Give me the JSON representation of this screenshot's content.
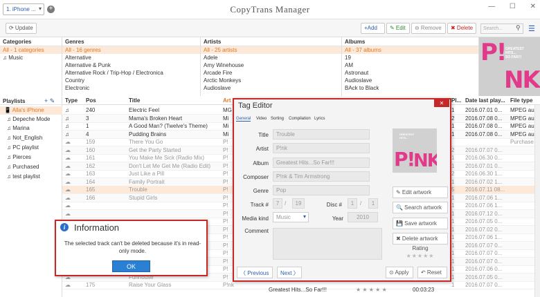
{
  "topbar": {
    "device": "1. iPhone ...",
    "add_device_glyph": "+",
    "app_title": "CopyTrans Manager",
    "window_controls": [
      "—",
      "☐",
      "✕"
    ]
  },
  "toolbar": {
    "update_label": "⟳ Update",
    "add_label": "+Add",
    "edit_label": "✎ Edit",
    "remove_label": "⊖ Remove",
    "delete_label": "✖ Delete",
    "search_placeholder": "Search..."
  },
  "categories": {
    "header": "Categories",
    "items": [
      "All - 1 categories",
      "♫ Music"
    ]
  },
  "genres": {
    "header": "Genres",
    "items": [
      "All - 16 genres",
      "Alternative",
      "Alternative & Punk",
      "Alternative Rock / Trip-Hop / Electronica",
      "Country",
      "Electronic"
    ]
  },
  "artists": {
    "header": "Artists",
    "items": [
      "All - 25 artists",
      "Adele",
      "Amy Winehouse",
      "Arcade Fire",
      "Arctic Monkeys",
      "Audioslave"
    ]
  },
  "albums": {
    "header": "Albums",
    "items": [
      "All - 37 albums",
      "19",
      "AM",
      "Astronaut",
      "Audioslave",
      "BAck to Black"
    ]
  },
  "playlists": {
    "header": "Playlists",
    "tools": "+ ✎",
    "items": [
      "Alla's iPhone",
      "Depeche Mode",
      "Marina",
      "Not_English",
      "PC playlist",
      "Pierces",
      "Purchased",
      "test playlist"
    ]
  },
  "table": {
    "headers": [
      "Type",
      "Pos",
      "Title",
      "Art",
      "Pl...",
      "Date last play...",
      "File type"
    ],
    "rows": [
      {
        "type": "♫",
        "pos": "240",
        "title": "Electric Feel",
        "artist": "MG",
        "pl": "1",
        "date": "2016.07.01 0...",
        "ftype": "MPEG au"
      },
      {
        "type": "♫",
        "pos": "3",
        "title": "Mama's Broken Heart",
        "artist": "Mi",
        "pl": "2",
        "date": "2016.07.08 0...",
        "ftype": "MPEG au"
      },
      {
        "type": "♫",
        "pos": "1",
        "title": "A Good Man? (Twelve's Theme)",
        "artist": "Mi",
        "pl": "1",
        "date": "2016.07.08 0...",
        "ftype": "MPEG au"
      },
      {
        "type": "♫",
        "pos": "4",
        "title": "Pudding Brains",
        "artist": "Mi",
        "pl": "1",
        "date": "2016.07.08 0...",
        "ftype": "MPEG au"
      },
      {
        "type": "☁",
        "pos": "159",
        "title": "There You Go",
        "artist": "P!",
        "pl": "",
        "date": "",
        "ftype": "Purchase"
      },
      {
        "type": "☁",
        "pos": "160",
        "title": "Get the Party Started",
        "artist": "P!",
        "pl": "2",
        "date": "2016.07.07 0...",
        "ftype": ""
      },
      {
        "type": "☁",
        "pos": "161",
        "title": "You Make Me Sick (Radio Mix)",
        "artist": "P!",
        "pl": "1",
        "date": "2016.06.30 0...",
        "ftype": ""
      },
      {
        "type": "☁",
        "pos": "162",
        "title": "Don't Let Me Get Me (Radio Edit)",
        "artist": "P!",
        "pl": "1",
        "date": "2016.07.01 0...",
        "ftype": ""
      },
      {
        "type": "☁",
        "pos": "163",
        "title": "Just Like a Pill",
        "artist": "P!",
        "pl": "2",
        "date": "2016.06.30 1...",
        "ftype": ""
      },
      {
        "type": "☁",
        "pos": "164",
        "title": "Family Portrait",
        "artist": "P!",
        "pl": "1",
        "date": "2016.07.02 1...",
        "ftype": ""
      },
      {
        "type": "☁",
        "pos": "165",
        "title": "Trouble",
        "artist": "P!",
        "pl": "5",
        "date": "2016.07.11 08...",
        "ftype": ""
      },
      {
        "type": "☁",
        "pos": "166",
        "title": "Stupid Girls",
        "artist": "P!",
        "pl": "1",
        "date": "2016.07.06 1...",
        "ftype": ""
      },
      {
        "type": "☁",
        "pos": "",
        "title": "",
        "artist": "P!",
        "pl": "1",
        "date": "2016.07.06 1...",
        "ftype": ""
      },
      {
        "type": "☁",
        "pos": "",
        "title": "",
        "artist": "P!",
        "pl": "1",
        "date": "2016.07.12 0...",
        "ftype": ""
      },
      {
        "type": "☁",
        "pos": "",
        "title": "",
        "artist": "P!",
        "pl": "1",
        "date": "2016.07.05 0...",
        "ftype": ""
      },
      {
        "type": "☁",
        "pos": "",
        "title": "",
        "artist": "P!",
        "pl": "1",
        "date": "2016.07.02 0...",
        "ftype": ""
      },
      {
        "type": "☁",
        "pos": "",
        "title": "",
        "artist": "P!",
        "pl": "1",
        "date": "2016.07.06 1...",
        "ftype": ""
      },
      {
        "type": "☁",
        "pos": "",
        "title": "",
        "artist": "P!",
        "pl": "1",
        "date": "2016.07.07 0...",
        "ftype": ""
      },
      {
        "type": "☁",
        "pos": "",
        "title": "",
        "artist": "P!",
        "pl": "1",
        "date": "2016.07.07 0...",
        "ftype": ""
      },
      {
        "type": "☁",
        "pos": "",
        "title": "",
        "artist": "P!",
        "pl": "1",
        "date": "2016.07.07 0...",
        "ftype": ""
      },
      {
        "type": "☁",
        "pos": "",
        "title": "",
        "artist": "P!",
        "pl": "1",
        "date": "2016.07.06 0...",
        "ftype": ""
      },
      {
        "type": "☁",
        "pos": "",
        "title": "Funhouse",
        "artist": "P!",
        "pl": "1",
        "date": "2016.07.05 0...",
        "ftype": ""
      },
      {
        "type": "☁",
        "pos": "175",
        "title": "Raise Your Glass",
        "artist": "P!nk",
        "pl": "1",
        "date": "2016.07.07 0...",
        "ftype": ""
      }
    ],
    "last_row_album": "Greatest Hits...So Far!!!",
    "last_row_stars": "★ ★ ★ ★ ★",
    "last_row_time": "00:03:23"
  },
  "info_dialog": {
    "icon": "i",
    "title": "Information",
    "message": "The selected track can't be deleted because it's in read-only mode.",
    "ok_label": "OK"
  },
  "tag_editor": {
    "title": "Tag Editor",
    "close": "✕",
    "tabs": [
      "General",
      "Video",
      "Sorting",
      "Compilation",
      "Lyrics"
    ],
    "labels": {
      "title": "Title",
      "artist": "Artist",
      "album": "Album",
      "composer": "Composer",
      "genre": "Genre",
      "track": "Track #",
      "disc": "Disc #",
      "media_kind": "Media kind",
      "year": "Year",
      "comment": "Comment"
    },
    "values": {
      "title": "Trouble",
      "artist": "P!nk",
      "album": "Greatest Hits...So Far!!!",
      "composer": "P!nk & Tim Armstrong",
      "genre": "Pop",
      "track": "7",
      "track_total": "19",
      "disc": "1",
      "disc_total": "1",
      "media_kind": "Music",
      "year": "2010"
    },
    "art_buttons": [
      "✎ Edit artwork",
      "🔍 Search artwork",
      "💾 Save artwork",
      "✖ Delete artwork"
    ],
    "rating_label": "Rating",
    "stars": "★★★★★",
    "previous_label": "〈 Previous",
    "next_label": "Next 〉",
    "apply_label": "⊙ Apply",
    "reset_label": "↶ Reset"
  },
  "art": {
    "line1": "GREATEST",
    "line2": "HITS...",
    "line3": "SO FAR!!!",
    "letters": "P!NK"
  },
  "colors": {
    "accent_orange": "#e07a22",
    "selection_bg": "#fde9d9",
    "dialog_border": "#c62828",
    "ok_blue": "#2a80d2",
    "art_pink": "#e23a8a"
  }
}
